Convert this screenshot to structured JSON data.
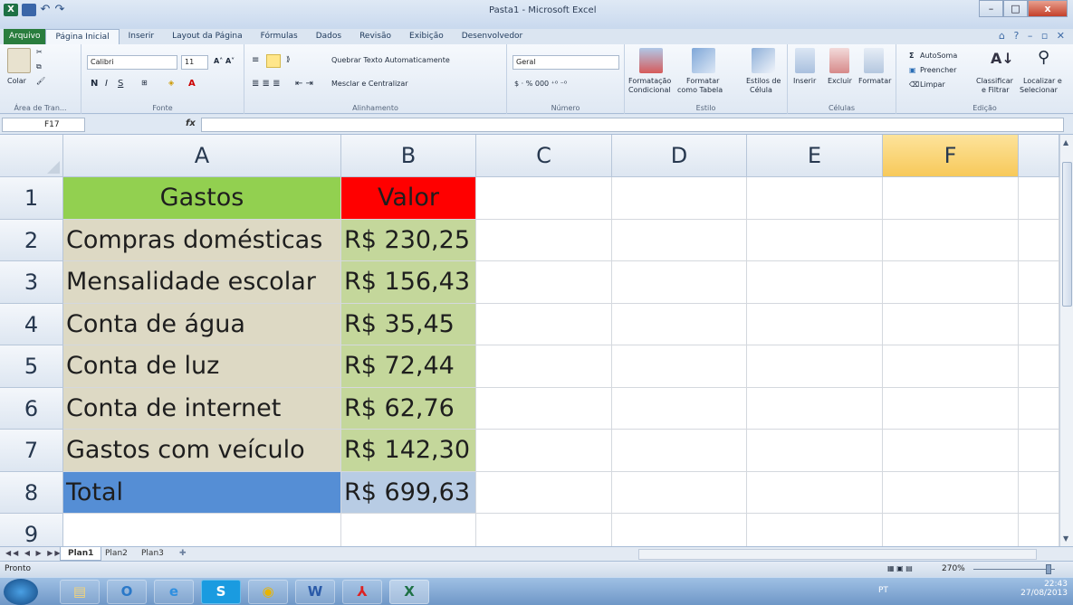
{
  "window": {
    "title": "Pasta1 - Microsoft Excel"
  },
  "tabs": [
    "Arquivo",
    "Página Inicial",
    "Inserir",
    "Layout da Página",
    "Fórmulas",
    "Dados",
    "Revisão",
    "Exibição",
    "Desenvolvedor"
  ],
  "ribbon": {
    "clipboard": {
      "paste": "Colar",
      "label": "Área de Tran..."
    },
    "font": {
      "name": "Calibri",
      "size": "11",
      "label": "Fonte"
    },
    "alignment": {
      "wrap": "Quebrar Texto Automaticamente",
      "merge": "Mesclar e Centralizar",
      "label": "Alinhamento"
    },
    "number": {
      "format": "Geral",
      "label": "Número"
    },
    "styles": {
      "cond1": "Formatação",
      "cond2": "Condicional",
      "table1": "Formatar",
      "table2": "como Tabela",
      "cell1": "Estilos de",
      "cell2": "Célula",
      "label": "Estilo"
    },
    "cells": {
      "insert": "Inserir",
      "delete": "Excluir",
      "format": "Formatar",
      "label": "Células"
    },
    "editing": {
      "autosum": "AutoSoma",
      "fill": "Preencher",
      "clear": "Limpar",
      "sort1": "Classificar",
      "sort2": "e Filtrar",
      "find1": "Localizar e",
      "find2": "Selecionar",
      "label": "Edição"
    }
  },
  "formula_bar": {
    "name_box": "F17",
    "fx": "fx",
    "value": ""
  },
  "columns": [
    "A",
    "B",
    "C",
    "D",
    "E",
    "F"
  ],
  "rows": [
    {
      "num": "1",
      "a": "Gastos",
      "b": "Valor"
    },
    {
      "num": "2",
      "a": "Compras domésticas",
      "b": "R$ 230,25"
    },
    {
      "num": "3",
      "a": "Mensalidade escolar",
      "b": "R$ 156,43"
    },
    {
      "num": "4",
      "a": "Conta de água",
      "b": "R$ 35,45"
    },
    {
      "num": "5",
      "a": "Conta de luz",
      "b": "R$ 72,44"
    },
    {
      "num": "6",
      "a": "Conta de internet",
      "b": "R$ 62,76"
    },
    {
      "num": "7",
      "a": "Gastos com veículo",
      "b": "R$ 142,30"
    },
    {
      "num": "8",
      "a": "Total",
      "b": "R$ 699,63"
    },
    {
      "num": "9",
      "a": "",
      "b": ""
    }
  ],
  "colors": {
    "header_a": "#92d050",
    "header_b": "#ff0000",
    "body_a": "#ddd9c4",
    "body_b": "#c4d79b",
    "total_a": "#558ed5",
    "total_b": "#b8cce4"
  },
  "sheets": [
    "Plan1",
    "Plan2",
    "Plan3"
  ],
  "status": {
    "mode": "Pronto",
    "zoom": "270%"
  },
  "taskbar": {
    "apps": [
      "explorer",
      "outlook",
      "internet-explorer",
      "skype",
      "chrome",
      "word",
      "acrobat",
      "excel"
    ],
    "lang": "PT",
    "time": "22:43",
    "date": "27/08/2013"
  }
}
